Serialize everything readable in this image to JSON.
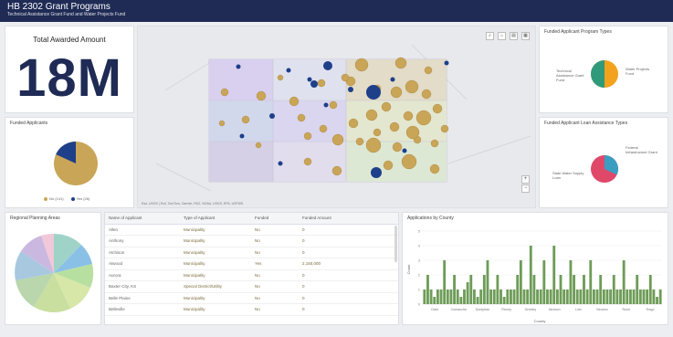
{
  "header": {
    "title": "HB 2302 Grant Programs",
    "subtitle": "Technical Assistance Grant Fund and Water Projects Fund"
  },
  "kpi": {
    "title": "Total Awarded Amount",
    "value": "18M"
  },
  "funded_applicants": {
    "title": "Funded Applicants",
    "legend": [
      "No (141)",
      "Yes (26)"
    ],
    "colors": [
      "#c9a558",
      "#1e3f8a"
    ]
  },
  "regional": {
    "title": "Regional Planning Areas"
  },
  "program_types": {
    "title": "Funded Applicant Program Types",
    "label_left": "Technical Assistance Grant Fund",
    "label_right": "Water Projects Fund",
    "colors": [
      "#2f9a79",
      "#f2a21d"
    ]
  },
  "loan_types": {
    "title": "Funded Applicant Loan Assistance Types",
    "label_right": "Federal Infrastructure Grant",
    "label_left": "State Water Supply Loan",
    "colors": [
      "#e0486a",
      "#3a9ec2"
    ]
  },
  "map": {
    "attribution": "Esri, USGS | Esri, TomTom, Garmin, FAO, NOAA, USGS, EPA, USFWS",
    "zoom_in": "+",
    "zoom_out": "−"
  },
  "table": {
    "headers": [
      "Name of Applicant",
      "Type of Applicant",
      "Funded",
      "Funded Amount"
    ],
    "rows": [
      [
        "Allen",
        "Municipality",
        "No",
        "0"
      ],
      [
        "Anthony",
        "Municipality",
        "No",
        "0"
      ],
      [
        "Atchison",
        "Municipality",
        "No",
        "0"
      ],
      [
        "Atwood",
        "Municipality",
        "Yes",
        "2,150,000"
      ],
      [
        "Aurora",
        "Municipality",
        "No",
        "0"
      ],
      [
        "Baxter City, KS",
        "Special District/Utility",
        "No",
        "0"
      ],
      [
        "Belle Plaine",
        "Municipality",
        "No",
        "0"
      ],
      [
        "Belleville",
        "Municipality",
        "No",
        "0"
      ]
    ]
  },
  "chart_data": {
    "type": "bar",
    "title": "Applications by County",
    "xlabel": "County",
    "ylabel": "Count",
    "ylim": [
      0,
      5
    ],
    "tick_labels": [
      "Clark",
      "Comanche",
      "Doniphan",
      "Finney",
      "Greeley",
      "Jackson",
      "Linn",
      "Neosho",
      "Rush",
      "Trego"
    ],
    "values": [
      1,
      2,
      1,
      0.5,
      1,
      1,
      3,
      1,
      1,
      2,
      1,
      0.5,
      1,
      1.5,
      2,
      1,
      0.5,
      1,
      2,
      3,
      1,
      1,
      2,
      1,
      0.5,
      1,
      1,
      1,
      2,
      3,
      1,
      1,
      4,
      2,
      1,
      1,
      3,
      1,
      1,
      4,
      1,
      2,
      1,
      1,
      3,
      2,
      1,
      1,
      2,
      1,
      3,
      1,
      1,
      2,
      1,
      1,
      1,
      2,
      1,
      1,
      3,
      1,
      1,
      1,
      2,
      1,
      1,
      1,
      2,
      1,
      0.5,
      1
    ],
    "color": "#6e9c58"
  }
}
